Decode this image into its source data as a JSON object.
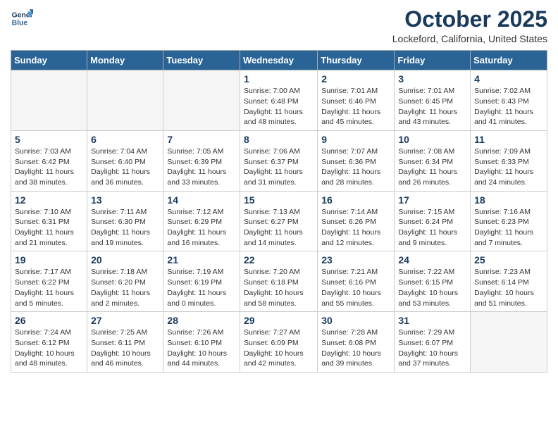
{
  "header": {
    "logo_line1": "General",
    "logo_line2": "Blue",
    "month": "October 2025",
    "location": "Lockeford, California, United States"
  },
  "weekdays": [
    "Sunday",
    "Monday",
    "Tuesday",
    "Wednesday",
    "Thursday",
    "Friday",
    "Saturday"
  ],
  "weeks": [
    [
      {
        "day": "",
        "info": ""
      },
      {
        "day": "",
        "info": ""
      },
      {
        "day": "",
        "info": ""
      },
      {
        "day": "1",
        "info": "Sunrise: 7:00 AM\nSunset: 6:48 PM\nDaylight: 11 hours\nand 48 minutes."
      },
      {
        "day": "2",
        "info": "Sunrise: 7:01 AM\nSunset: 6:46 PM\nDaylight: 11 hours\nand 45 minutes."
      },
      {
        "day": "3",
        "info": "Sunrise: 7:01 AM\nSunset: 6:45 PM\nDaylight: 11 hours\nand 43 minutes."
      },
      {
        "day": "4",
        "info": "Sunrise: 7:02 AM\nSunset: 6:43 PM\nDaylight: 11 hours\nand 41 minutes."
      }
    ],
    [
      {
        "day": "5",
        "info": "Sunrise: 7:03 AM\nSunset: 6:42 PM\nDaylight: 11 hours\nand 38 minutes."
      },
      {
        "day": "6",
        "info": "Sunrise: 7:04 AM\nSunset: 6:40 PM\nDaylight: 11 hours\nand 36 minutes."
      },
      {
        "day": "7",
        "info": "Sunrise: 7:05 AM\nSunset: 6:39 PM\nDaylight: 11 hours\nand 33 minutes."
      },
      {
        "day": "8",
        "info": "Sunrise: 7:06 AM\nSunset: 6:37 PM\nDaylight: 11 hours\nand 31 minutes."
      },
      {
        "day": "9",
        "info": "Sunrise: 7:07 AM\nSunset: 6:36 PM\nDaylight: 11 hours\nand 28 minutes."
      },
      {
        "day": "10",
        "info": "Sunrise: 7:08 AM\nSunset: 6:34 PM\nDaylight: 11 hours\nand 26 minutes."
      },
      {
        "day": "11",
        "info": "Sunrise: 7:09 AM\nSunset: 6:33 PM\nDaylight: 11 hours\nand 24 minutes."
      }
    ],
    [
      {
        "day": "12",
        "info": "Sunrise: 7:10 AM\nSunset: 6:31 PM\nDaylight: 11 hours\nand 21 minutes."
      },
      {
        "day": "13",
        "info": "Sunrise: 7:11 AM\nSunset: 6:30 PM\nDaylight: 11 hours\nand 19 minutes."
      },
      {
        "day": "14",
        "info": "Sunrise: 7:12 AM\nSunset: 6:29 PM\nDaylight: 11 hours\nand 16 minutes."
      },
      {
        "day": "15",
        "info": "Sunrise: 7:13 AM\nSunset: 6:27 PM\nDaylight: 11 hours\nand 14 minutes."
      },
      {
        "day": "16",
        "info": "Sunrise: 7:14 AM\nSunset: 6:26 PM\nDaylight: 11 hours\nand 12 minutes."
      },
      {
        "day": "17",
        "info": "Sunrise: 7:15 AM\nSunset: 6:24 PM\nDaylight: 11 hours\nand 9 minutes."
      },
      {
        "day": "18",
        "info": "Sunrise: 7:16 AM\nSunset: 6:23 PM\nDaylight: 11 hours\nand 7 minutes."
      }
    ],
    [
      {
        "day": "19",
        "info": "Sunrise: 7:17 AM\nSunset: 6:22 PM\nDaylight: 11 hours\nand 5 minutes."
      },
      {
        "day": "20",
        "info": "Sunrise: 7:18 AM\nSunset: 6:20 PM\nDaylight: 11 hours\nand 2 minutes."
      },
      {
        "day": "21",
        "info": "Sunrise: 7:19 AM\nSunset: 6:19 PM\nDaylight: 11 hours\nand 0 minutes."
      },
      {
        "day": "22",
        "info": "Sunrise: 7:20 AM\nSunset: 6:18 PM\nDaylight: 10 hours\nand 58 minutes."
      },
      {
        "day": "23",
        "info": "Sunrise: 7:21 AM\nSunset: 6:16 PM\nDaylight: 10 hours\nand 55 minutes."
      },
      {
        "day": "24",
        "info": "Sunrise: 7:22 AM\nSunset: 6:15 PM\nDaylight: 10 hours\nand 53 minutes."
      },
      {
        "day": "25",
        "info": "Sunrise: 7:23 AM\nSunset: 6:14 PM\nDaylight: 10 hours\nand 51 minutes."
      }
    ],
    [
      {
        "day": "26",
        "info": "Sunrise: 7:24 AM\nSunset: 6:12 PM\nDaylight: 10 hours\nand 48 minutes."
      },
      {
        "day": "27",
        "info": "Sunrise: 7:25 AM\nSunset: 6:11 PM\nDaylight: 10 hours\nand 46 minutes."
      },
      {
        "day": "28",
        "info": "Sunrise: 7:26 AM\nSunset: 6:10 PM\nDaylight: 10 hours\nand 44 minutes."
      },
      {
        "day": "29",
        "info": "Sunrise: 7:27 AM\nSunset: 6:09 PM\nDaylight: 10 hours\nand 42 minutes."
      },
      {
        "day": "30",
        "info": "Sunrise: 7:28 AM\nSunset: 6:08 PM\nDaylight: 10 hours\nand 39 minutes."
      },
      {
        "day": "31",
        "info": "Sunrise: 7:29 AM\nSunset: 6:07 PM\nDaylight: 10 hours\nand 37 minutes."
      },
      {
        "day": "",
        "info": ""
      }
    ]
  ]
}
